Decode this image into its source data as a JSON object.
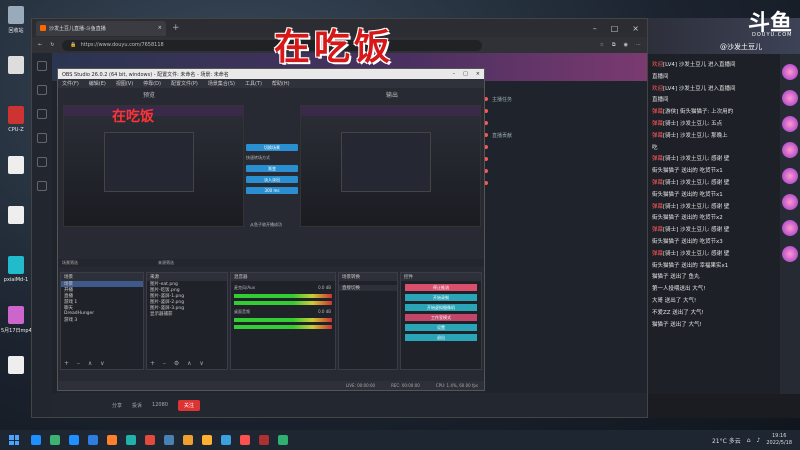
{
  "overlay": {
    "title": "在吃饭"
  },
  "watermark": {
    "logo": "斗鱼",
    "sub": "DOUYU.COM",
    "user": "@沙发土豆儿"
  },
  "desktop": {
    "icons": [
      {
        "label": "回收站",
        "color": "#9ab"
      },
      {
        "label": "",
        "color": "#ddd"
      },
      {
        "label": "CPU-Z",
        "color": "#c33"
      },
      {
        "label": "",
        "color": "#eee"
      },
      {
        "label": "",
        "color": "#eee"
      },
      {
        "label": "pxiaiMd-1",
        "color": "#2bc"
      },
      {
        "label": "5月17日mp4",
        "color": "#c6c"
      },
      {
        "label": "",
        "color": "#eee"
      }
    ]
  },
  "browser": {
    "tab_title": "沙发土豆儿直播-斗鱼直播",
    "url": "https://www.douyu.com/7658118"
  },
  "obs": {
    "title": "OBS Studio 26.0.2 (64 bit, windows) - 配置文件: 未命名 - 场景: 未命名",
    "menu": [
      "文件(F)",
      "编辑(E)",
      "视图(V)",
      "停靠(D)",
      "配置文件(P)",
      "场景集合(S)",
      "工具(T)",
      "帮助(H)"
    ],
    "preview_label": "预览",
    "program_label": "输出",
    "preview_caption": "在吃饭",
    "transition_buttons": [
      "切换场景",
      "渐变",
      "淡入淡出"
    ],
    "transition_label": "快速转场方式",
    "transition_duration": "300 ms",
    "transition_note": "从鱼子收开播成功",
    "scene_bar": [
      "场景筛选",
      "来源筛选"
    ],
    "scenes_header": "场景",
    "scenes": [
      "场景",
      "开播",
      "直播",
      "游戏 1",
      "聊天",
      "DreadHunger",
      "游戏 3"
    ],
    "sources_header": "来源",
    "sources": [
      "图片-eat.png",
      "图片-吃饭.png",
      "图片-竖屏-1.png",
      "图片-竖屏-2.png",
      "图片-竖屏-3.png",
      "显示器捕获"
    ],
    "mixer_header": "混音器",
    "mixer": [
      {
        "name": "麦克风/Aux",
        "db": "0.0 dB"
      },
      {
        "name": "桌面音频",
        "db": "0.0 dB"
      }
    ],
    "transitions_header": "场景转换",
    "transition_select": "直接切换",
    "controls_header": "控件",
    "controls": [
      "停止推流",
      "开始录制",
      "开始虚拟摄像机",
      "工作室模式",
      "设置",
      "退出"
    ],
    "status": [
      "LIVE: 00:00:00",
      "REC: 00:00:00",
      "CPU: 1.4%, 60.00 fps"
    ]
  },
  "page": {
    "chat_rows": [
      "主播任务",
      "",
      "",
      "直播贡献",
      "",
      "",
      "",
      ""
    ],
    "bottom": [
      "分享",
      "投诉",
      "12080",
      "关注"
    ]
  },
  "right_chat": [
    {
      "tag": "欢迎",
      "text": "[LV4] 沙发土豆儿 进入直播间"
    },
    {
      "tag": "",
      "text": "直播间"
    },
    {
      "tag": "欢迎",
      "text": "[LV4] 沙发土豆儿 进入直播间"
    },
    {
      "tag": "",
      "text": "直播间"
    },
    {
      "tag": "弹幕",
      "text": "[游侠] 街头猫猫子: 上次用的"
    },
    {
      "tag": "弹幕",
      "text": "[骑士] 沙发土豆儿: 五点"
    },
    {
      "tag": "弹幕",
      "text": "[骑士] 沙发土豆儿: 那晚上"
    },
    {
      "tag": "",
      "text": "吃"
    },
    {
      "tag": "弹幕",
      "text": "[骑士] 沙发土豆儿: 感谢 壁"
    },
    {
      "tag": "",
      "text": "街头猫猫子 送出的 吃货节x1"
    },
    {
      "tag": "弹幕",
      "text": "[骑士] 沙发土豆儿: 感谢 壁"
    },
    {
      "tag": "",
      "text": "街头猫猫子 送出的 吃货节x1"
    },
    {
      "tag": "弹幕",
      "text": "[骑士] 沙发土豆儿: 感谢 壁"
    },
    {
      "tag": "",
      "text": "街头猫猫子 送出的 吃货节x2"
    },
    {
      "tag": "弹幕",
      "text": "[骑士] 沙发土豆儿: 感谢 壁"
    },
    {
      "tag": "",
      "text": "街头猫猫子 送出的 吃货节x3"
    },
    {
      "tag": "弹幕",
      "text": "[骑士] 沙发土豆儿: 感谢 壁"
    },
    {
      "tag": "",
      "text": "街头猫猫子 送出的 幸福果实x1"
    },
    {
      "tag": "",
      "text": ""
    },
    {
      "tag": "",
      "text": "猫猫子 送出了 鱼丸"
    },
    {
      "tag": "",
      "text": "第一人投喂送出 大气!"
    },
    {
      "tag": "",
      "text": "大哥 送出了 大气!"
    },
    {
      "tag": "",
      "text": "不爱ZZ 送出了 大气!"
    },
    {
      "tag": "",
      "text": "猫猫子 送出了 大气!"
    }
  ],
  "taskbar": {
    "apps": [
      "#1e90ff",
      "#3cb371",
      "#1e90ff",
      "#2f7de1",
      "#ff7f2a",
      "#20b2aa",
      "#e24a3b",
      "#4682b4",
      "#f0a030",
      "#ffb030",
      "#3aa0e0",
      "#ff5050",
      "#b03030",
      "#30b070"
    ],
    "weather": "21°C 多云",
    "time": "19:16",
    "date": "2022/5/18"
  }
}
